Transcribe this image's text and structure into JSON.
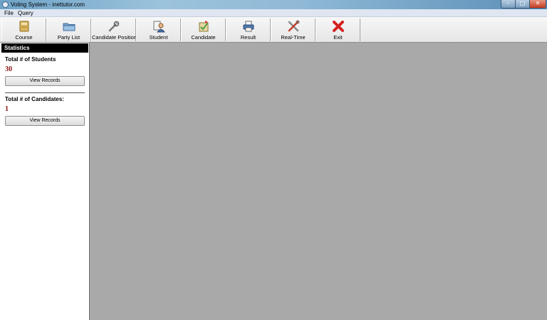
{
  "window": {
    "title": "Voting System - inettutor.com"
  },
  "menu": [
    {
      "label": "File"
    },
    {
      "label": "Query"
    }
  ],
  "toolbar": [
    {
      "label": "Course",
      "icon": "book-icon"
    },
    {
      "label": "Party List",
      "icon": "folder-icon"
    },
    {
      "label": "Candidate Position",
      "icon": "tools-icon"
    },
    {
      "label": "Student",
      "icon": "student-icon"
    },
    {
      "label": "Candidate",
      "icon": "candidate-icon"
    },
    {
      "label": "Result",
      "icon": "printer-icon"
    },
    {
      "label": "Real-Time",
      "icon": "wrench-icon"
    },
    {
      "label": "Exit",
      "icon": "exit-icon"
    }
  ],
  "sidebar": {
    "header": "Statistics",
    "students": {
      "label": "Total # of Students",
      "value": "30",
      "button": "View Records"
    },
    "candidates": {
      "label": "Total # of Candidates:",
      "value": "1",
      "button": "View Records"
    }
  },
  "colors": {
    "stat_value": "#8b1010",
    "content_bg": "#a9a9a9",
    "exit_red": "#d42020"
  }
}
